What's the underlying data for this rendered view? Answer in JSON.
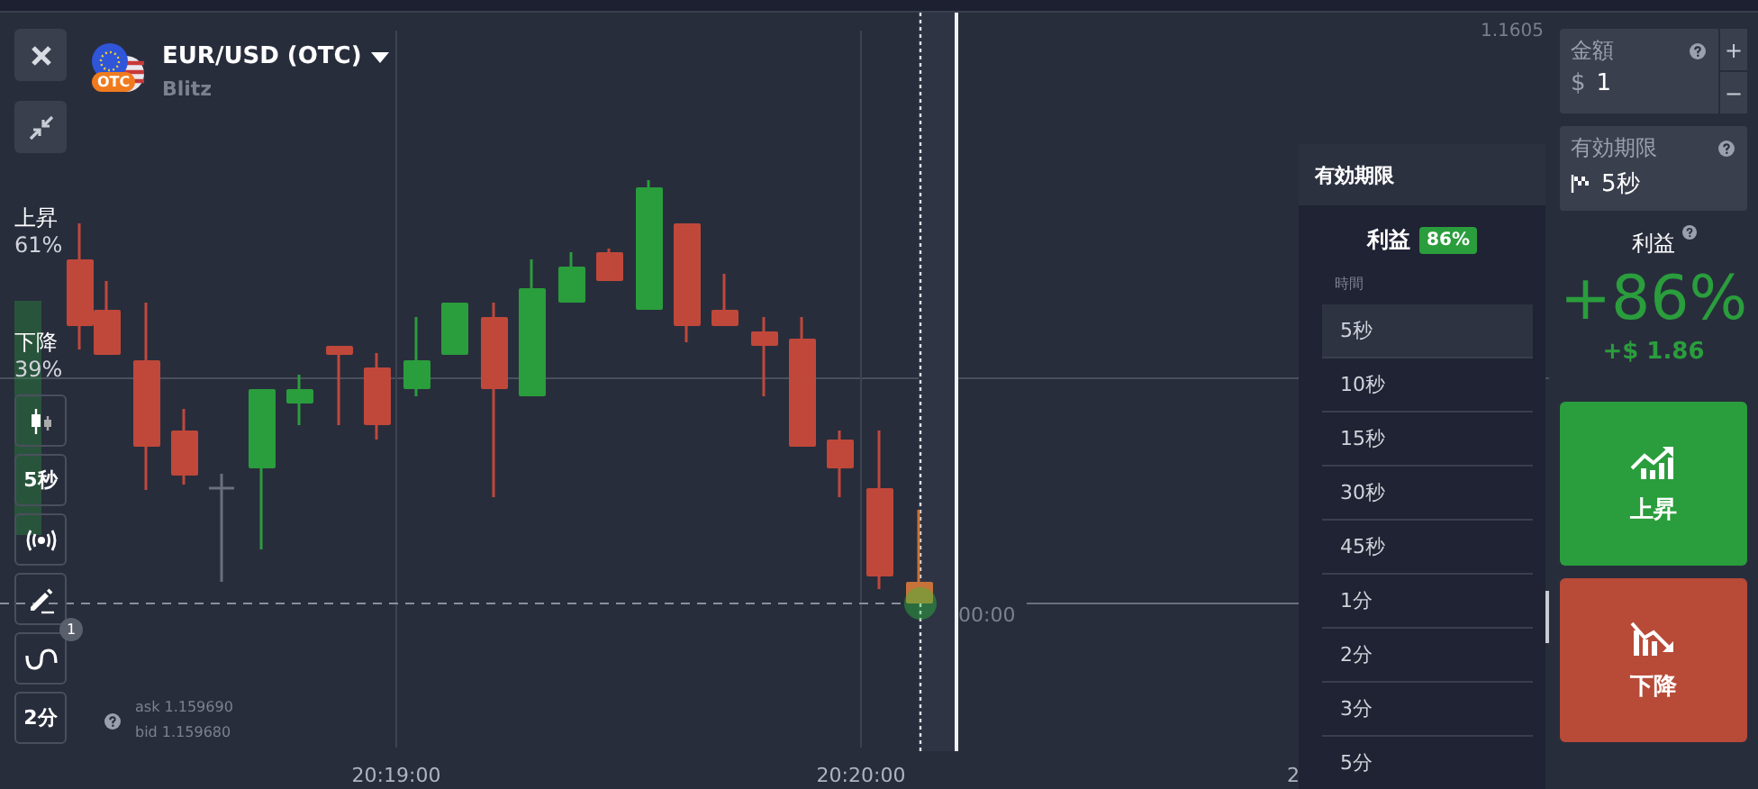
{
  "asset": {
    "name": "EUR/USD (OTC)",
    "mode": "Blitz",
    "badge": "OTC"
  },
  "toolbar_top": [
    {
      "kind": "close"
    },
    {
      "kind": "collapse"
    }
  ],
  "sentiment": {
    "up_label": "上昇",
    "up_percent": "61%",
    "down_label": "下降",
    "down_percent": "39%"
  },
  "toolbar": [
    {
      "kind": "chart-type"
    },
    {
      "kind": "text",
      "label": "5秒"
    },
    {
      "kind": "signals"
    },
    {
      "kind": "draw"
    },
    {
      "kind": "indicators",
      "badge": "1"
    },
    {
      "kind": "text",
      "label": "2分"
    }
  ],
  "quote": {
    "ask": "ask 1.159690",
    "bid": "bid 1.159680"
  },
  "price_axis": [
    "1.1605"
  ],
  "time_axis": [
    {
      "label": "20:19:00"
    },
    {
      "label": "20:20:00"
    },
    {
      "label": "2"
    }
  ],
  "current_price_time": "00:00",
  "expiry_menu": {
    "title": "有効期限",
    "profit_label": "利益",
    "profit_badge": "86%",
    "column_label": "時間",
    "options": [
      {
        "label": "5秒",
        "selected": true
      },
      {
        "label": "10秒",
        "selected": false
      },
      {
        "label": "15秒",
        "selected": false
      },
      {
        "label": "30秒",
        "selected": false
      },
      {
        "label": "45秒",
        "selected": false
      },
      {
        "label": "1分",
        "selected": false
      },
      {
        "label": "2分",
        "selected": false
      },
      {
        "label": "3分",
        "selected": false
      },
      {
        "label": "5分",
        "selected": false
      }
    ]
  },
  "trade_panel": {
    "amount": {
      "label": "金額",
      "currency": "$",
      "value": "1",
      "plus": "+",
      "minus": "−"
    },
    "expiry": {
      "label": "有効期限",
      "value": "5秒"
    },
    "profit": {
      "label": "利益",
      "percent": "+86%",
      "payout": "+$ 1.86"
    },
    "buttons": [
      {
        "kind": "up",
        "label": "上昇"
      },
      {
        "kind": "down",
        "label": "下降"
      }
    ]
  }
}
